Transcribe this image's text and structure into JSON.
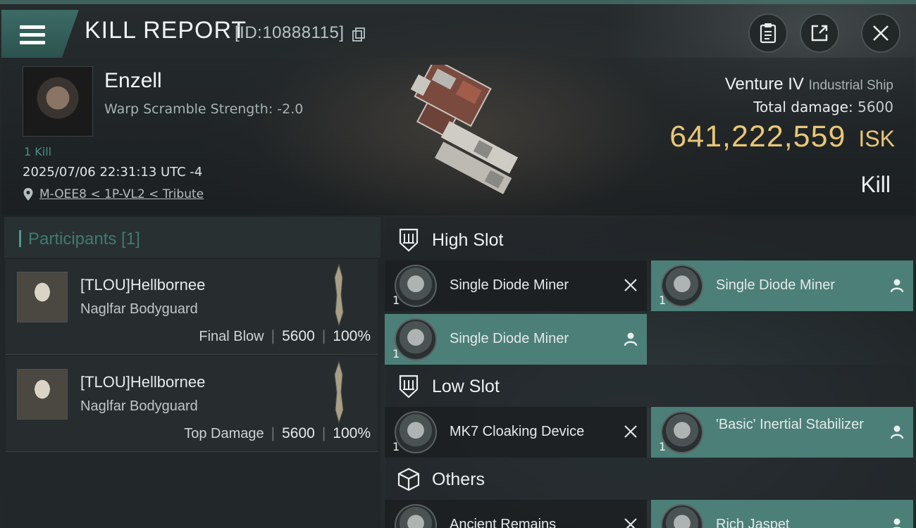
{
  "header": {
    "title": "KILL REPORT",
    "report_id": "[ID:10888115]"
  },
  "victim": {
    "name": "Enzell",
    "warp_scramble": "Warp Scramble Strength: -2.0",
    "kills": "1 Kill",
    "timestamp": "2025/07/06 22:31:13 UTC -4",
    "location": "M-OEE8 < 1P-VL2 < Tribute",
    "ship_name": "Venture IV",
    "ship_class": "Industrial Ship",
    "total_damage_label": "Total damage:",
    "total_damage": "5600",
    "isk_value": "641,222,559",
    "isk_unit": "ISK",
    "result": "Kill"
  },
  "participants": {
    "title": "Participants [1]",
    "items": [
      {
        "name": "[TLOU]Hellbornee",
        "ship": "Naglfar Bodyguard",
        "tag": "Final Blow",
        "damage": "5600",
        "percent": "100%"
      },
      {
        "name": "[TLOU]Hellbornee",
        "ship": "Naglfar Bodyguard",
        "tag": "Top Damage",
        "damage": "5600",
        "percent": "100%"
      }
    ]
  },
  "slots": {
    "high": {
      "label": "High Slot",
      "modules": [
        {
          "name": "Single Diode Miner",
          "qty": "1",
          "status": "destroyed"
        },
        {
          "name": "Single Diode Miner",
          "qty": "1",
          "status": "dropped"
        },
        {
          "name": "Single Diode Miner",
          "qty": "1",
          "status": "dropped"
        }
      ]
    },
    "low": {
      "label": "Low Slot",
      "modules": [
        {
          "name": "MK7 Cloaking Device",
          "qty": "1",
          "status": "destroyed"
        },
        {
          "name": "'Basic' Inertial Stabilizer",
          "qty": "1",
          "status": "dropped"
        }
      ]
    },
    "others": {
      "label": "Others",
      "modules": [
        {
          "name": "Ancient Remains",
          "qty": "",
          "status": "destroyed"
        },
        {
          "name": "Rich Jaspet",
          "qty": "",
          "status": "dropped"
        }
      ]
    }
  },
  "colors": {
    "accent": "#4c7f78",
    "isk": "#e8c677",
    "participants_title": "#3e7b73"
  },
  "icons": {
    "menu": "hamburger-icon",
    "copy": "copy-icon",
    "clipboard": "clipboard-icon",
    "share": "share-icon",
    "close": "close-icon",
    "location": "location-pin-icon",
    "slot_high": "high-slot-icon",
    "slot_low": "low-slot-icon",
    "slot_others": "cube-icon",
    "destroyed": "x-icon",
    "dropped": "person-icon"
  }
}
